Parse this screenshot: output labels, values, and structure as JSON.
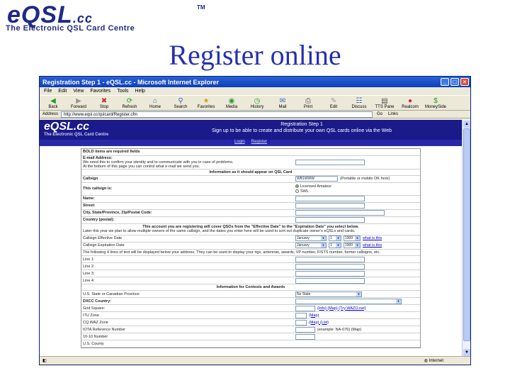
{
  "slide": {
    "logo_text": "eQSL",
    "logo_cc": ".cc",
    "logo_tm": "TM",
    "logo_sub": "The Electronic QSL Card Centre",
    "title": "Register online"
  },
  "window": {
    "title": "Registration Step 1 - eQSL.cc - Microsoft Internet Explorer",
    "menu": [
      "File",
      "Edit",
      "View",
      "Favorites",
      "Tools",
      "Help"
    ],
    "toolbar": [
      {
        "label": "Back",
        "icon": "back-arrow-icon"
      },
      {
        "label": "Forward",
        "icon": "forward-arrow-icon"
      },
      {
        "label": "Stop",
        "icon": "stop-icon"
      },
      {
        "label": "Refresh",
        "icon": "refresh-icon"
      },
      {
        "label": "Home",
        "icon": "home-icon"
      },
      {
        "label": "Search",
        "icon": "search-icon"
      },
      {
        "label": "Favorites",
        "icon": "favorites-icon"
      },
      {
        "label": "Media",
        "icon": "media-icon"
      },
      {
        "label": "History",
        "icon": "history-icon"
      },
      {
        "label": "Mail",
        "icon": "mail-icon"
      },
      {
        "label": "Print",
        "icon": "print-icon"
      },
      {
        "label": "Edit",
        "icon": "edit-icon"
      },
      {
        "label": "Discuss",
        "icon": "discuss-icon"
      },
      {
        "label": "TTS Pane",
        "icon": "tts-icon"
      },
      {
        "label": "Realcom",
        "icon": "realcom-icon"
      },
      {
        "label": "MoneySide",
        "icon": "moneyside-icon"
      }
    ],
    "address_label": "Address",
    "address_url": "http://www.eqsl.cc/qslcard/Register.cfm",
    "go_label": "Go",
    "links_label": "Links",
    "status_zone": "Internet"
  },
  "site": {
    "logo": "eQSL.cc",
    "logo_sub": "The Electronic QSL Card Centre",
    "banner_title": "Registration Step 1",
    "banner_text": "Sign up to be able to create and distribute your own QSL cards online via the Web",
    "links": [
      "Login",
      "Register"
    ]
  },
  "form": {
    "bold_note": "BOLD items are required fields",
    "email_label": "E-mail Address:",
    "email_note1": "We need this to confirm your identity and to communicate with you in case of problems.",
    "email_note2": "At the bottom of this page you can control what e-mail we send you.",
    "section_card": "Information as it should appear on QSL Card",
    "callsign_label": "Callsign",
    "callsign_value": "WB1WWW",
    "callsign_hint": "(Portable or mobile OK here)",
    "callsign_is_label": "This callsign is:",
    "radio_licensed": "Licensed Amateur",
    "radio_swl": "SWL",
    "name_label": "Name:",
    "street_label": "Street:",
    "city_label": "City, State/Province, Zip/Postal Code:",
    "country_label": "Country (postal):",
    "dates_note1": "This account you are registering will cover QSOs from the \"Effective Date\" to the \"Expiration Date\" you select below.",
    "dates_note2": "Later this year we plan to allow multiple owners of the same callsign, and the dates you enter here will be used to sort out duplicate owner's eQSLs and cards.",
    "eff_label": "Callsign Effective Date",
    "exp_label": "Callsign Expiration Date",
    "month_value": "January",
    "day_value": "1",
    "year_value": "1900",
    "what_is_this": "what is this",
    "lines_note": "The following 4 lines of text will be displayed below your address. They can be used to display your rigs, antennas, awards, VP number, FISTS number, former callsigns, etc.",
    "line1_label": "Line 1:",
    "line2_label": "Line 2:",
    "line3_label": "Line 3:",
    "line4_label": "Line 4:",
    "section_contests": "Information for Contests and Awards",
    "state_label": "U.S. State or Canadian Province:",
    "state_value": "No State",
    "dxcc_label": "DXCC Country:",
    "grid_label": "Grid Square:",
    "grid_links": "(Info) (Map) (Try WAZO.net)",
    "itu_label": "ITU Zone",
    "itu_links": "(Map)",
    "cq_label": "CQ WAZ Zone",
    "cq_links": "(Map) (List)",
    "iota_label": "IOTA Reference Number",
    "iota_hint": "(example: NA-076) (Map)",
    "tenten_label": "10-10 Number",
    "us_county_label": "U.S. County"
  }
}
